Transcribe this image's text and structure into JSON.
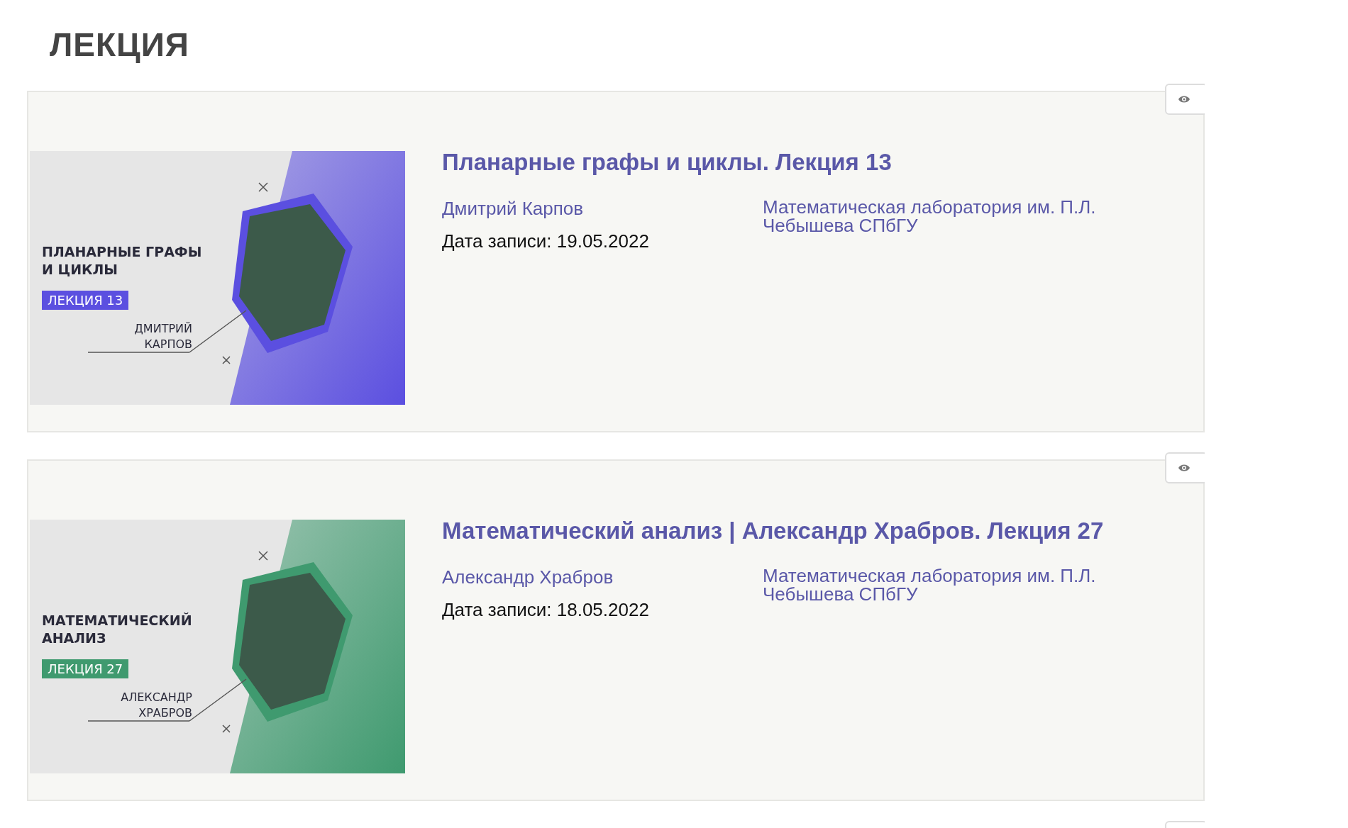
{
  "heading": "ЛЕКЦИЯ",
  "cards": [
    {
      "title": "Планарные графы и циклы. Лекция 13",
      "author": "Дмитрий Карпов",
      "organization": "Математическая лаборатория им. П.Л. Чебышева СПбГУ",
      "date": "Дата записи: 19.05.2022",
      "thumbnail": {
        "title_lines": [
          "ПЛАНАРНЫЕ ГРАФЫ",
          "И ЦИКЛЫ"
        ],
        "badge": "ЛЕКЦИЯ 13",
        "name_lines": [
          "ДМИТРИЙ",
          "КАРПОВ"
        ],
        "color": "#5b4fe0"
      }
    },
    {
      "title": "Математический анализ | Александр Храбров. Лекция 27",
      "author": "Александр Храбров",
      "organization": "Математическая лаборатория им. П.Л. Чебышева СПбГУ",
      "date": "Дата записи: 18.05.2022",
      "thumbnail": {
        "title_lines": [
          "МАТЕМАТИЧЕСКИЙ",
          "АНАЛИЗ"
        ],
        "badge": "ЛЕКЦИЯ 27",
        "name_lines": [
          "АЛЕКСАНДР",
          "ХРАБРОВ"
        ],
        "color": "#3f9a6f"
      }
    }
  ],
  "next_card_peek": true
}
